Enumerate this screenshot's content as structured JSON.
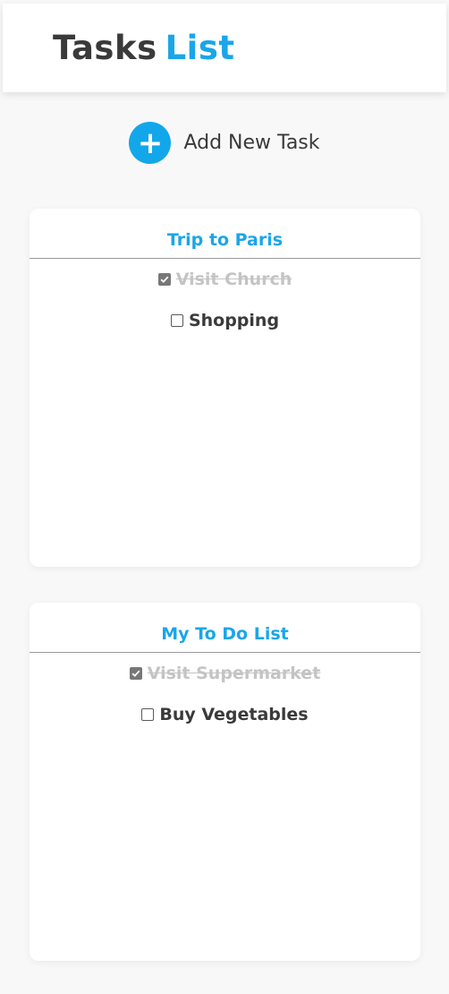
{
  "header": {
    "title_part1": "Tasks",
    "title_part2": "List",
    "accent_color": "#1aa6e8"
  },
  "add_task": {
    "icon": "plus-icon",
    "label": "Add New Task"
  },
  "lists": [
    {
      "title": "Trip to Paris",
      "tasks": [
        {
          "label": "Visit Church",
          "done": true
        },
        {
          "label": "Shopping",
          "done": false
        }
      ]
    },
    {
      "title": "My To Do List",
      "tasks": [
        {
          "label": "Visit Supermarket",
          "done": true
        },
        {
          "label": "Buy Vegetables",
          "done": false
        }
      ]
    }
  ]
}
